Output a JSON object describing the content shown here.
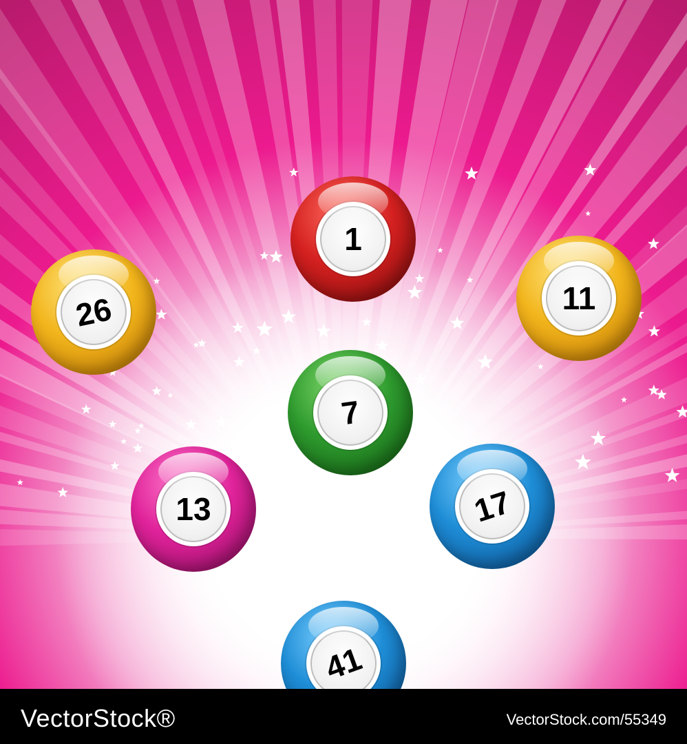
{
  "image": {
    "background": {
      "top_color": "#C21C77",
      "mid_color": "#EC1A8E",
      "glow_color": "#FFFFFF"
    }
  },
  "balls": [
    {
      "number": "1",
      "color": "#D42020",
      "shade": "#7A0A0A",
      "highlight": "#FF6A5E"
    },
    {
      "number": "26",
      "color": "#F2B51C",
      "shade": "#B96F00",
      "highlight": "#FFE580"
    },
    {
      "number": "11",
      "color": "#F2B51C",
      "shade": "#B96F00",
      "highlight": "#FFE580"
    },
    {
      "number": "7",
      "color": "#2E9A2E",
      "shade": "#105A10",
      "highlight": "#80D86A"
    },
    {
      "number": "13",
      "color": "#E0239A",
      "shade": "#8A0A5C",
      "highlight": "#FF7ACB"
    },
    {
      "number": "17",
      "color": "#1E8DD6",
      "shade": "#0A4A8A",
      "highlight": "#7ED0FF"
    },
    {
      "number": "41",
      "color": "#1E8DD6",
      "shade": "#0A4A8A",
      "highlight": "#7ED0FF"
    }
  ],
  "footer": {
    "brand": "VectorStock®",
    "reference": "VectorStock.com/55349"
  }
}
